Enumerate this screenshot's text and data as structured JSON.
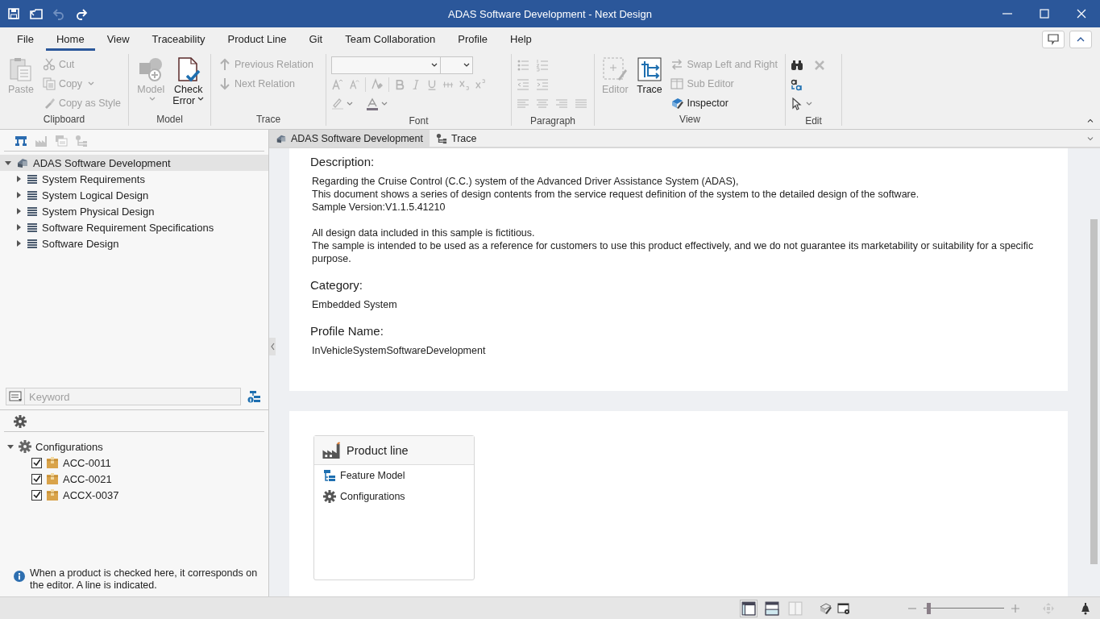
{
  "window": {
    "title": "ADAS Software Development - Next Design"
  },
  "menu_tabs": [
    {
      "label": "File",
      "selected": false
    },
    {
      "label": "Home",
      "selected": true
    },
    {
      "label": "View",
      "selected": false
    },
    {
      "label": "Traceability",
      "selected": false
    },
    {
      "label": "Product Line",
      "selected": false
    },
    {
      "label": "Git",
      "selected": false
    },
    {
      "label": "Team Collaboration",
      "selected": false
    },
    {
      "label": "Profile",
      "selected": false
    },
    {
      "label": "Help",
      "selected": false
    }
  ],
  "ribbon": {
    "groups": [
      {
        "label": "Clipboard",
        "kind": "buttons",
        "items": [
          {
            "label": "Paste",
            "kind": "large",
            "disabled": true,
            "dropdown": false
          },
          {
            "label": "Cut",
            "kind": "small",
            "disabled": true,
            "dropdown": false
          },
          {
            "label": "Copy",
            "kind": "small",
            "disabled": true,
            "dropdown": true
          },
          {
            "label": "Copy as Style",
            "kind": "small",
            "disabled": true,
            "dropdown": false
          }
        ]
      },
      {
        "label": "Model",
        "kind": "buttons",
        "items": [
          {
            "label": "Model",
            "kind": "large",
            "disabled": true,
            "dropdown": true
          },
          {
            "label": "Check Error",
            "kind": "large",
            "disabled": false,
            "dropdown": true
          }
        ]
      },
      {
        "label": "Trace",
        "kind": "buttons",
        "items": [
          {
            "label": "Previous Relation",
            "kind": "small",
            "disabled": true,
            "dropdown": false
          },
          {
            "label": "Next Relation",
            "kind": "small",
            "disabled": true,
            "dropdown": false
          }
        ]
      },
      {
        "label": "Font",
        "kind": "font"
      },
      {
        "label": "Paragraph",
        "kind": "paragraph"
      },
      {
        "label": "View",
        "kind": "buttons",
        "items": [
          {
            "label": "Editor",
            "kind": "large",
            "disabled": true,
            "dropdown": false
          },
          {
            "label": "Trace",
            "kind": "large",
            "disabled": false,
            "dropdown": false
          },
          {
            "label": "Swap Left and Right",
            "kind": "small",
            "disabled": true,
            "dropdown": false
          },
          {
            "label": "Sub Editor",
            "kind": "small",
            "disabled": true,
            "dropdown": false
          },
          {
            "label": "Inspector",
            "kind": "small",
            "disabled": false,
            "dropdown": false
          }
        ]
      },
      {
        "label": "Edit",
        "kind": "edit"
      }
    ]
  },
  "explorer": {
    "tree": {
      "label": "ADAS Software Development",
      "selected": true,
      "expanded": true,
      "children": [
        {
          "label": "System Requirements",
          "expanded": false
        },
        {
          "label": "System Logical Design",
          "expanded": false
        },
        {
          "label": "System Physical Design",
          "expanded": false
        },
        {
          "label": "Software Requirement Specifications",
          "expanded": false
        },
        {
          "label": "Software Design",
          "expanded": false
        }
      ]
    },
    "search": {
      "placeholder": "Keyword"
    },
    "configurations": {
      "label": "Configurations",
      "expanded": true,
      "children": [
        {
          "label": "ACC-0011",
          "checked": true
        },
        {
          "label": "ACC-0021",
          "checked": true
        },
        {
          "label": "ACCX-0037",
          "checked": true
        }
      ]
    },
    "info": "When a product is checked here, it corresponds on the editor. A line is indicated."
  },
  "doc_tabs": [
    {
      "label": "ADAS Software Development",
      "selected": true
    },
    {
      "label": "Trace",
      "selected": false
    }
  ],
  "overview": {
    "fields": [
      {
        "label": "Description:",
        "paragraphs": [
          [
            "Regarding the Cruise Control (C.C.) system of the Advanced Driver Assistance System (ADAS),",
            "This document shows a series of design contents from the service request definition of the system to the detailed design of the software.",
            "Sample Version:V1.1.5.41210"
          ],
          [
            "All design data included in this sample is fictitious.",
            "The sample is intended to be used as a reference for customers to use this product effectively, and we do not guarantee its marketability or suitability for a specific purpose."
          ]
        ]
      },
      {
        "label": "Category:",
        "paragraphs": [
          [
            "Embedded System"
          ]
        ]
      },
      {
        "label": "Profile Name:",
        "paragraphs": [
          [
            "InVehicleSystemSoftwareDevelopment"
          ]
        ]
      }
    ]
  },
  "product_line": {
    "title": "Product line",
    "items": [
      {
        "label": "Feature Model"
      },
      {
        "label": "Configurations"
      }
    ]
  },
  "status_bar": {
    "layout_buttons": [
      {
        "selected": true,
        "disabled": false
      },
      {
        "selected": false,
        "disabled": false
      },
      {
        "selected": false,
        "disabled": true
      }
    ],
    "zoom": {
      "level": 0.06
    }
  }
}
